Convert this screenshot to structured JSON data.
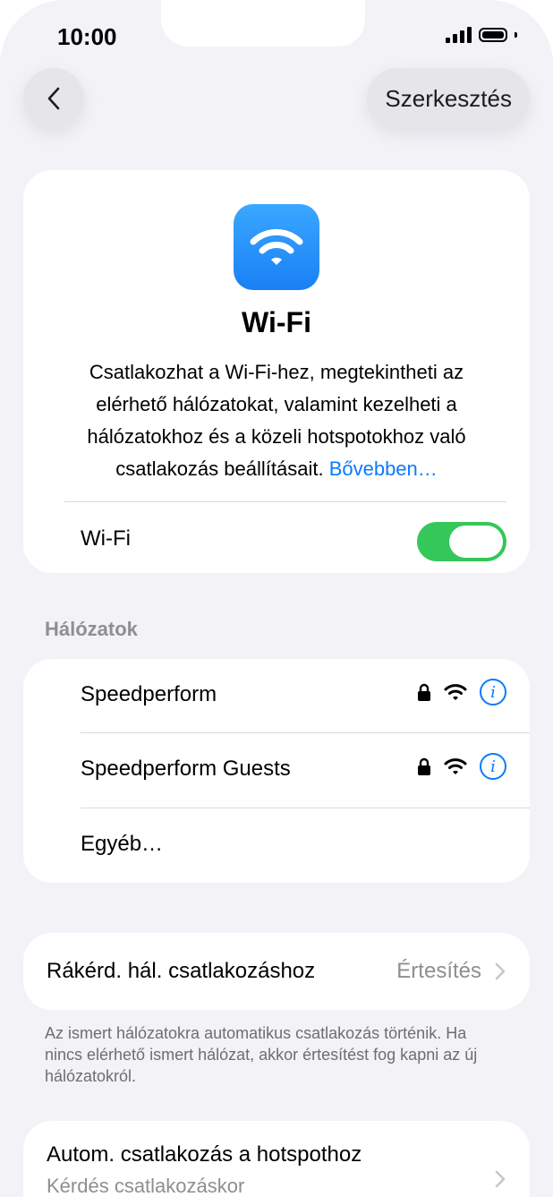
{
  "status_bar": {
    "time": "10:00"
  },
  "nav": {
    "back_icon": "chevron-left-icon",
    "edit_label": "Szerkesztés"
  },
  "hero": {
    "icon": "wifi-icon",
    "icon_color": "#1a80f5",
    "title": "Wi-Fi",
    "description": "Csatlakozhat a Wi-Fi-hez, megtekintheti az elérhető hálózatokat, valamint kezelheti a hálózatokhoz és a közeli hotspotokhoz való csatlakozás beállításait.",
    "learn_more": "Bővebben…",
    "toggle_label": "Wi-Fi",
    "toggle_on": true,
    "toggle_color": "#34c759"
  },
  "networks": {
    "header": "Hálózatok",
    "items": [
      {
        "name": "Speedperform",
        "secured": true
      },
      {
        "name": "Speedperform Guests",
        "secured": true
      }
    ],
    "other_label": "Egyéb…"
  },
  "ask_to_join": {
    "label": "Rákérd. hál. csatlakozáshoz",
    "value": "Értesítés",
    "footnote": "Az ismert hálózatokra automatikus csatlakozás történik. Ha nincs elérhető ismert hálózat, akkor értesítést fog kapni az új hálózatokról."
  },
  "auto_join_hotspot": {
    "label": "Autom. csatlakozás a hotspothoz",
    "value": "Kérdés csatlakozáskor"
  },
  "accent_color": "#0a7aff"
}
